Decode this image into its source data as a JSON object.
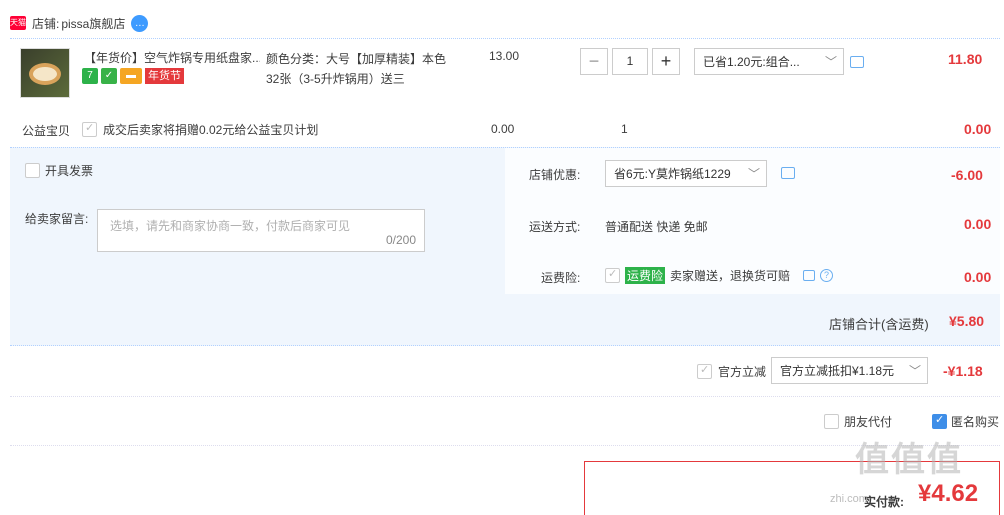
{
  "store": {
    "label": "店铺:",
    "name": "pissa旗舰店",
    "tmall_badge": "天猫"
  },
  "item": {
    "title": "【年货价】空气炸锅专用纸盘家...",
    "tag_festival": "年货节",
    "sku_line1": "颜色分类：大号【加厚精装】本色",
    "sku_line2": "32张（3-5升炸锅用）送三",
    "unit_price": "13.00",
    "qty": "1",
    "promo_select": "已省1.20元:组合...",
    "subtotal": "11.80"
  },
  "charity": {
    "label": "公益宝贝",
    "text": "成交后卖家将捐赠0.02元给公益宝贝计划",
    "price": "0.00",
    "qty": "1",
    "subtotal": "0.00"
  },
  "invoice": {
    "label": "开具发票"
  },
  "message": {
    "label": "给卖家留言:",
    "placeholder": "选填，请先和商家协商一致，付款后商家可见",
    "counter": "0/200"
  },
  "store_discount": {
    "label": "店铺优惠:",
    "select": "省6元:Y莫炸锅纸1229",
    "amount": "-6.00"
  },
  "shipping": {
    "label": "运送方式:",
    "value": "普通配送 快递 免邮",
    "amount": "0.00"
  },
  "insurance": {
    "label": "运费险:",
    "tag": "运费险",
    "text": "卖家赠送，退换货可赔",
    "amount": "0.00"
  },
  "store_total": {
    "label": "店铺合计(含运费)",
    "amount": "¥5.80"
  },
  "official": {
    "label": "官方立减",
    "select": "官方立减抵扣¥1.18元",
    "amount": "-¥1.18"
  },
  "options": {
    "friend_pay": "朋友代付",
    "anonymous": "匿名购买"
  },
  "payment": {
    "label": "实付款:",
    "amount": "¥4.62"
  },
  "watermark": {
    "text": "值值值",
    "url": "zhi.com"
  },
  "colors": {
    "accent_red": "#e4393c",
    "panel_blue": "#f0f6fd",
    "link_blue": "#3e8ee8"
  }
}
